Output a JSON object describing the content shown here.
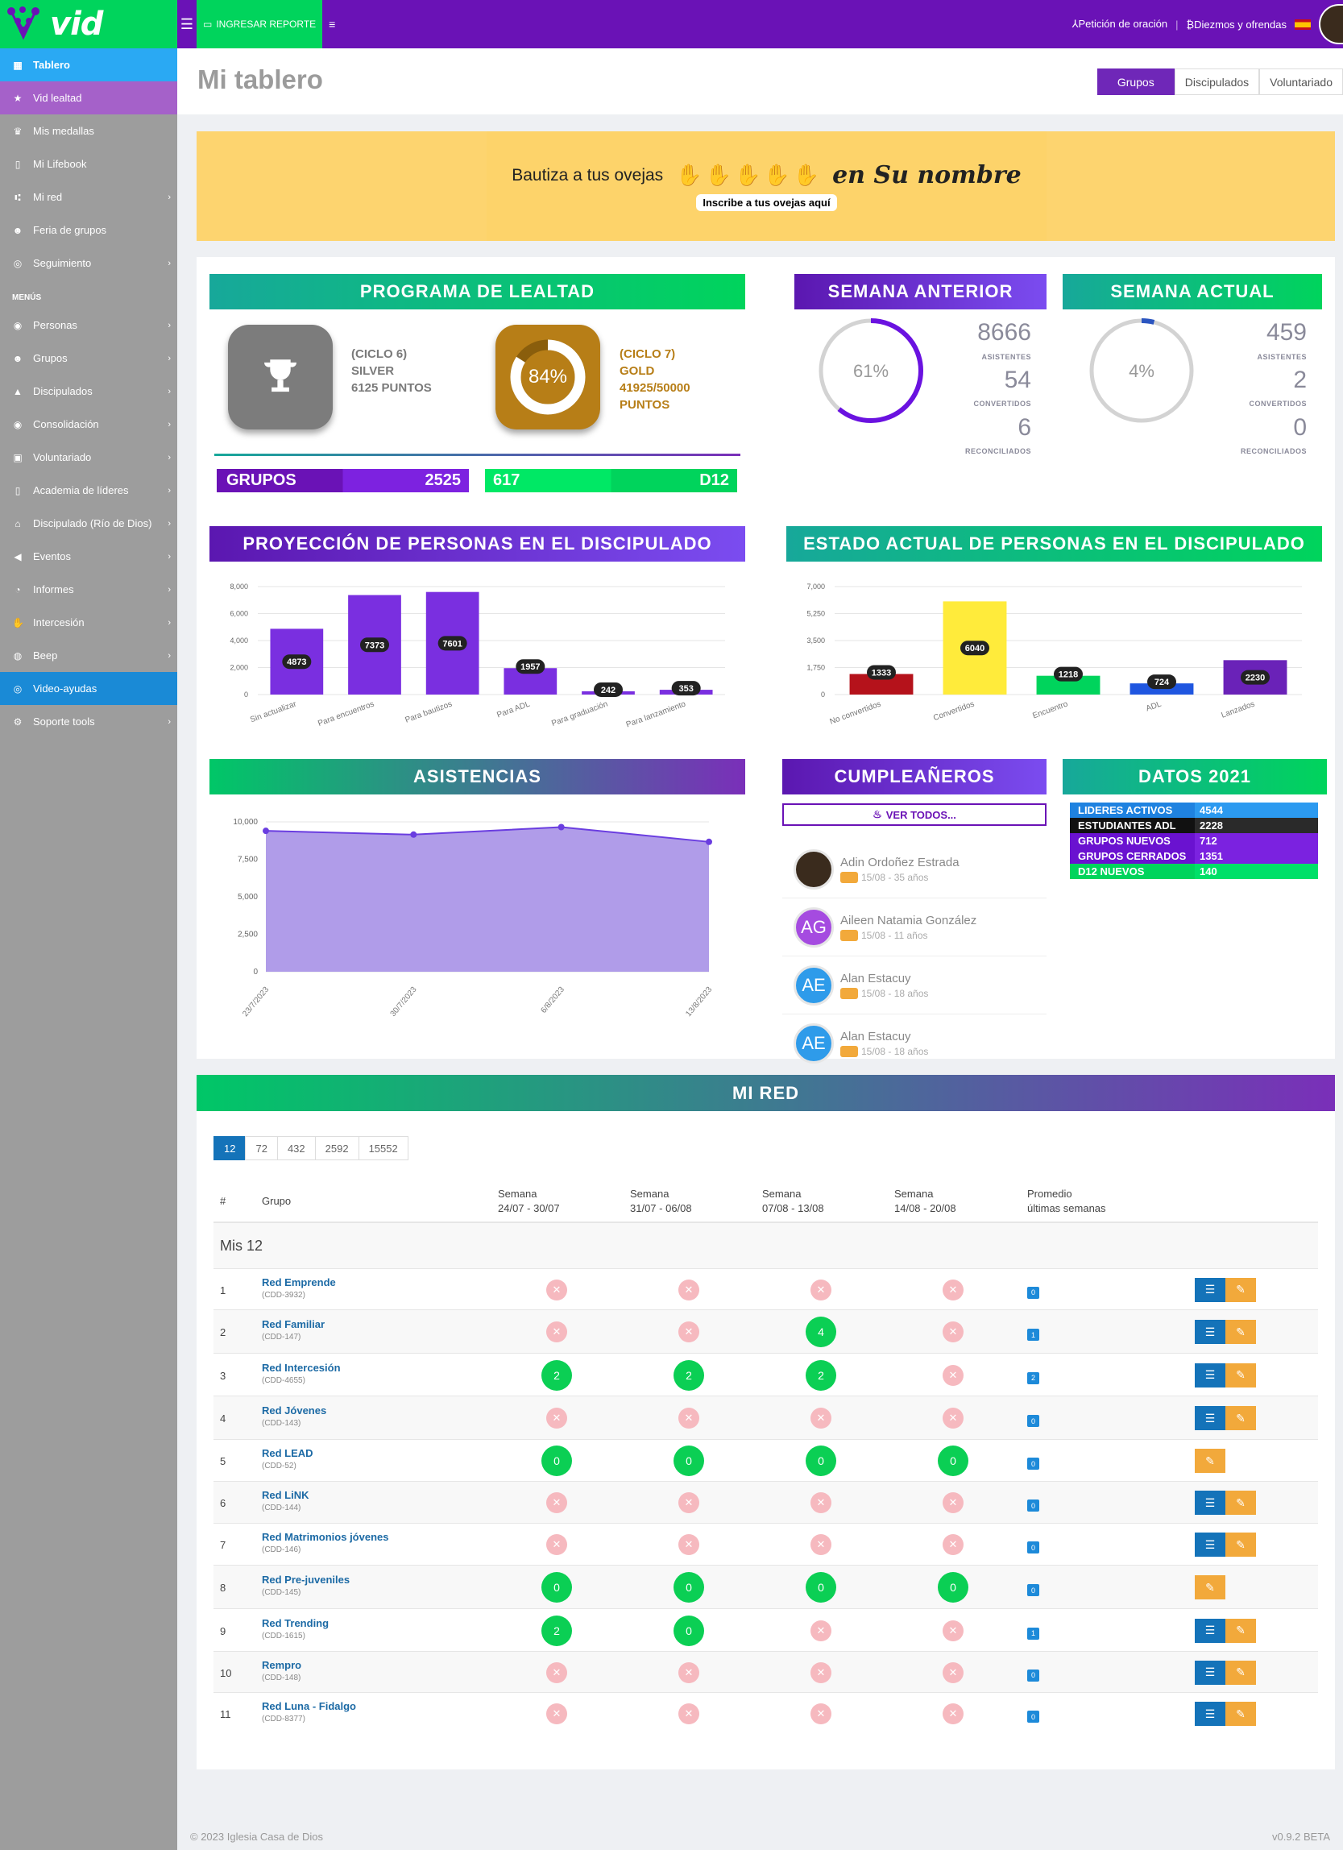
{
  "brand": "vid",
  "topbar": {
    "report_label": "INGRESAR REPORTE",
    "prayer_label": "Petición de oración",
    "tithes_label": "Diezmos y ofrendas"
  },
  "sidebar": {
    "items": [
      {
        "label": "Tablero",
        "icon": "grid-icon"
      },
      {
        "label": "Vid lealtad",
        "icon": "star-icon"
      },
      {
        "label": "Mis medallas",
        "icon": "trophy-icon"
      },
      {
        "label": "Mi Lifebook",
        "icon": "book-icon"
      },
      {
        "label": "Mi red",
        "icon": "network-icon",
        "chev": true
      },
      {
        "label": "Feria de grupos",
        "icon": "users-icon"
      },
      {
        "label": "Seguimiento",
        "icon": "target-icon",
        "chev": true
      }
    ],
    "menu_title": "MENÚS",
    "menu_items": [
      {
        "label": "Personas",
        "icon": "user-icon"
      },
      {
        "label": "Grupos",
        "icon": "users-icon"
      },
      {
        "label": "Discipulados",
        "icon": "graduation-icon"
      },
      {
        "label": "Consolidación",
        "icon": "eye-icon"
      },
      {
        "label": "Voluntariado",
        "icon": "lock-icon"
      },
      {
        "label": "Academia de líderes",
        "icon": "book-icon"
      },
      {
        "label": "Discipulado (Río de Dios)",
        "icon": "home-icon"
      },
      {
        "label": "Eventos",
        "icon": "megaphone-icon"
      },
      {
        "label": "Informes",
        "icon": "chart-icon"
      },
      {
        "label": "Intercesión",
        "icon": "hand-icon"
      },
      {
        "label": "Beep",
        "icon": "globe-icon"
      },
      {
        "label": "Video-ayudas",
        "icon": "lifebuoy-icon"
      },
      {
        "label": "Soporte tools",
        "icon": "cogs-icon"
      }
    ]
  },
  "page": {
    "title": "Mi tablero",
    "tabs": [
      "Grupos",
      "Discipulados",
      "Voluntariado"
    ]
  },
  "banner": {
    "text": "Bautiza a tus ovejas",
    "script": "en Su nombre",
    "cta": "Inscribe a tus ovejas aquí"
  },
  "loyalty": {
    "title": "PROGRAMA DE LEALTAD",
    "prev": {
      "cycle": "(CICLO 6)",
      "level": "SILVER",
      "points": "6125 PUNTOS"
    },
    "curr": {
      "cycle": "(CICLO 7)",
      "level": "GOLD",
      "points": "41925/50000",
      "points_label": "PUNTOS",
      "percent": "84%",
      "pct_value": 84
    },
    "groups_label": "GRUPOS",
    "groups_value": "2525",
    "d12_value": "617",
    "d12_label": "D12"
  },
  "prev_week": {
    "title": "SEMANA ANTERIOR",
    "percent": "61%",
    "pct_value": 61,
    "asistentes": "8666",
    "convertidos": "54",
    "reconciliados": "6"
  },
  "curr_week": {
    "title": "SEMANA ACTUAL",
    "percent": "4%",
    "pct_value": 4,
    "asistentes": "459",
    "convertidos": "2",
    "reconciliados": "0"
  },
  "labels": {
    "asistentes": "ASISTENTES",
    "convertidos": "CONVERTIDOS",
    "reconciliados": "RECONCILIADOS"
  },
  "chart_data": [
    {
      "type": "bar",
      "title": "PROYECCIÓN DE PERSONAS EN EL DISCIPULADO",
      "categories": [
        "Sin actualizar",
        "Para encuentros",
        "Para bautizos",
        "Para ADL",
        "Para graduación",
        "Para lanzamiento"
      ],
      "values": [
        4873,
        7373,
        7601,
        1957,
        242,
        353
      ],
      "ylim": [
        0,
        8000
      ],
      "yticks": [
        "0",
        "2,000",
        "4,000",
        "6,000",
        "8,000"
      ],
      "color": "#7a2fe0"
    },
    {
      "type": "bar",
      "title": "ESTADO ACTUAL DE PERSONAS EN EL DISCIPULADO",
      "categories": [
        "No convertidos",
        "Convertidos",
        "Encuentro",
        "ADL",
        "Lanzados"
      ],
      "values": [
        1333,
        6040,
        1218,
        724,
        2230
      ],
      "ylim": [
        0,
        7000
      ],
      "yticks": [
        "0",
        "1,750",
        "3,500",
        "5,250",
        "7,000"
      ],
      "colors": [
        "#b5121b",
        "#ffeb3b",
        "#00d45c",
        "#1f56e0",
        "#6a22b8"
      ]
    },
    {
      "type": "area",
      "title": "ASISTENCIAS",
      "categories": [
        "23/7/2023",
        "30/7/2023",
        "6/8/2023",
        "13/8/2023"
      ],
      "values": [
        9400,
        9150,
        9650,
        8666
      ],
      "ylim": [
        0,
        10000
      ],
      "yticks": [
        "0",
        "2,500",
        "5,000",
        "7,500",
        "10,000"
      ]
    }
  ],
  "birthdays": {
    "title": "CUMPLEAÑEROS",
    "button": "VER TODOS...",
    "items": [
      {
        "name": "Adin Ordoñez Estrada",
        "date": "15/08 - 35 años",
        "initials": "",
        "color": "#3a2b1d"
      },
      {
        "name": "Aileen Natamia González",
        "date": "15/08 - 11 años",
        "initials": "AG",
        "color": "#a54be0"
      },
      {
        "name": "Alan Estacuy",
        "date": "15/08 - 18 años",
        "initials": "AE",
        "color": "#2e9bea"
      },
      {
        "name": "Alan Estacuy",
        "date": "15/08 - 18 años",
        "initials": "AE",
        "color": "#2e9bea"
      }
    ]
  },
  "datos": {
    "title": "DATOS 2021",
    "rows": [
      {
        "k": "LIDERES ACTIVOS",
        "v": "4544",
        "c1": "#1f82e0",
        "c2": "#2c9af0"
      },
      {
        "k": "ESTUDIANTES ADL",
        "v": "2228",
        "c1": "#111111",
        "c2": "#2a2a2a"
      },
      {
        "k": "GRUPOS NUEVOS",
        "v": "712",
        "c1": "#6a12d0",
        "c2": "#7b22e0"
      },
      {
        "k": "GRUPOS CERRADOS",
        "v": "1351",
        "c1": "#6a12d0",
        "c2": "#7b22e0"
      },
      {
        "k": "D12 NUEVOS",
        "v": "140",
        "c1": "#00d45c",
        "c2": "#00e068"
      }
    ]
  },
  "mired": {
    "title": "MI RED",
    "pager": [
      "12",
      "72",
      "432",
      "2592",
      "15552"
    ],
    "headers": {
      "num": "#",
      "group": "Grupo",
      "w1a": "Semana",
      "w1b": "24/07 - 30/07",
      "w2a": "Semana",
      "w2b": "31/07 - 06/08",
      "w3a": "Semana",
      "w3b": "07/08 - 13/08",
      "w4a": "Semana",
      "w4b": "14/08 - 20/08",
      "avga": "Promedio",
      "avgb": "últimas semanas"
    },
    "section": "Mis 12",
    "rows": [
      {
        "n": "1",
        "name": "Red Emprende",
        "code": "(CDD-3932)",
        "w": [
          null,
          null,
          null,
          null
        ],
        "avg": "0",
        "list": true
      },
      {
        "n": "2",
        "name": "Red Familiar",
        "code": "(CDD-147)",
        "w": [
          null,
          null,
          "4",
          null
        ],
        "avg": "1",
        "list": true
      },
      {
        "n": "3",
        "name": "Red Intercesión",
        "code": "(CDD-4655)",
        "w": [
          "2",
          "2",
          "2",
          null
        ],
        "avg": "2",
        "list": true
      },
      {
        "n": "4",
        "name": "Red Jóvenes",
        "code": "(CDD-143)",
        "w": [
          null,
          null,
          null,
          null
        ],
        "avg": "0",
        "list": true
      },
      {
        "n": "5",
        "name": "Red LEAD",
        "code": "(CDD-52)",
        "w": [
          "0",
          "0",
          "0",
          "0"
        ],
        "avg": "0",
        "list": false
      },
      {
        "n": "6",
        "name": "Red LiNK",
        "code": "(CDD-144)",
        "w": [
          null,
          null,
          null,
          null
        ],
        "avg": "0",
        "list": true
      },
      {
        "n": "7",
        "name": "Red Matrimonios jóvenes",
        "code": "(CDD-146)",
        "w": [
          null,
          null,
          null,
          null
        ],
        "avg": "0",
        "list": true
      },
      {
        "n": "8",
        "name": "Red Pre-juveniles",
        "code": "(CDD-145)",
        "w": [
          "0",
          "0",
          "0",
          "0"
        ],
        "avg": "0",
        "list": false
      },
      {
        "n": "9",
        "name": "Red Trending",
        "code": "(CDD-1615)",
        "w": [
          "2",
          "0",
          null,
          null
        ],
        "avg": "1",
        "list": true
      },
      {
        "n": "10",
        "name": "Rempro",
        "code": "(CDD-148)",
        "w": [
          null,
          null,
          null,
          null
        ],
        "avg": "0",
        "list": true
      },
      {
        "n": "11",
        "name": "Red Luna - Fidalgo",
        "code": "(CDD-8377)",
        "w": [
          null,
          null,
          null,
          null
        ],
        "avg": "0",
        "list": true
      }
    ]
  },
  "footer": {
    "copyright": "© 2023 Iglesia Casa de Dios",
    "version": "v0.9.2 BETA"
  }
}
